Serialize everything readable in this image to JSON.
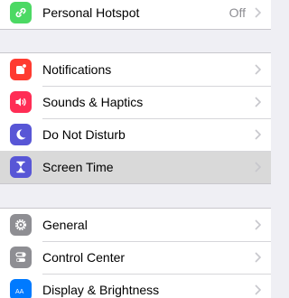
{
  "colors": {
    "background": "#efeff4",
    "hotspot_green": "#4cd964",
    "notifications_red": "#ff3b30",
    "sounds_pink": "#ff2d55",
    "dnd_purple": "#5856d6",
    "screentime_indigo": "#5856d6",
    "gray_icon": "#8e8e93",
    "display_blue": "#007aff",
    "highlight": "#d9d9d9"
  },
  "groups": [
    {
      "rows": [
        {
          "label": "Personal Hotspot",
          "value": "Off",
          "icon": "link-icon"
        }
      ]
    },
    {
      "rows": [
        {
          "label": "Notifications",
          "icon": "notifications-icon"
        },
        {
          "label": "Sounds & Haptics",
          "icon": "speaker-icon"
        },
        {
          "label": "Do Not Disturb",
          "icon": "moon-icon"
        },
        {
          "label": "Screen Time",
          "icon": "hourglass-icon",
          "highlighted": true
        }
      ]
    },
    {
      "rows": [
        {
          "label": "General",
          "icon": "gear-icon"
        },
        {
          "label": "Control Center",
          "icon": "toggles-icon"
        },
        {
          "label": "Display & Brightness",
          "icon": "text-size-icon",
          "icon_text": "AA"
        }
      ]
    }
  ]
}
